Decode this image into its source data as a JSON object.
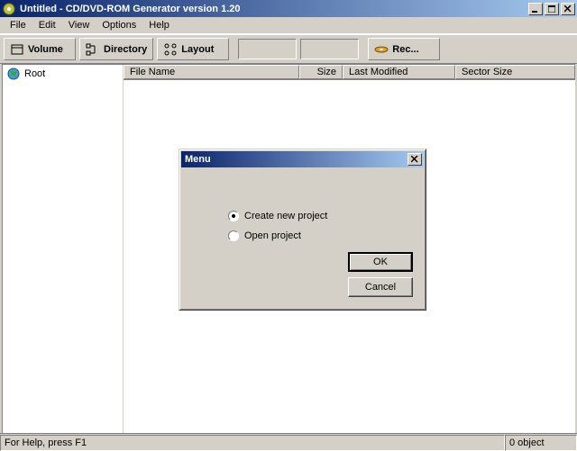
{
  "window": {
    "title": "Untitled - CD/DVD-ROM Generator version 1.20"
  },
  "menubar": {
    "items": [
      "File",
      "Edit",
      "View",
      "Options",
      "Help"
    ]
  },
  "toolbar": {
    "volume": "Volume",
    "directory": "Directory",
    "layout": "Layout",
    "rec": "Rec..."
  },
  "tree": {
    "root": "Root"
  },
  "list": {
    "columns": {
      "filename": "File Name",
      "size": "Size",
      "lastmod": "Last Modified",
      "sector": "Sector Size"
    }
  },
  "dialog": {
    "title": "Menu",
    "options": {
      "create": "Create new project",
      "open": "Open project"
    },
    "buttons": {
      "ok": "OK",
      "cancel": "Cancel"
    },
    "selected": "create"
  },
  "statusbar": {
    "help": "For Help, press F1",
    "objects": "0 object"
  }
}
